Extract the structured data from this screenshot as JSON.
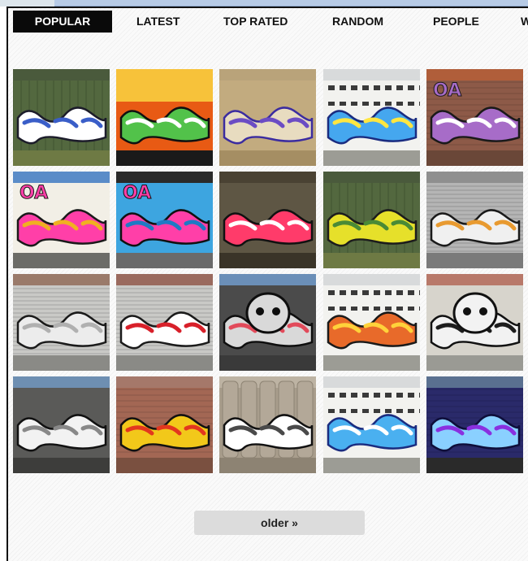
{
  "nav": {
    "tabs": [
      {
        "label": "POPULAR",
        "active": true
      },
      {
        "label": "LATEST"
      },
      {
        "label": "TOP RATED"
      },
      {
        "label": "RANDOM"
      },
      {
        "label": "PEOPLE"
      },
      {
        "label": "W"
      }
    ]
  },
  "gallery": {
    "tiles": [
      {
        "tag": "",
        "sky": "#4a5a3c",
        "wall": "#53683f",
        "ground": "#6e7a44",
        "c1": "#ffffff",
        "c2": "#3a5ec8",
        "stroke": "#1c1c2a",
        "kind": "train"
      },
      {
        "tag": "",
        "sky": "#f4a300",
        "wall": "#e85a14",
        "ground": "#1a1a1a",
        "c1": "#52c24a",
        "c2": "#ffffff",
        "stroke": "#111111",
        "kind": "sunset"
      },
      {
        "tag": "",
        "sky": "#b9a37a",
        "wall": "#c2ab7f",
        "ground": "#a58e63",
        "c1": "#e8dcc0",
        "c2": "#6b4cc4",
        "stroke": "#3b2ca0",
        "kind": "wall"
      },
      {
        "tag": "",
        "sky": "#d8dadb",
        "wall": "#f2f2ef",
        "ground": "#9c9c95",
        "c1": "#45a7ef",
        "c2": "#ffe640",
        "stroke": "#1a2c80",
        "kind": "ship"
      },
      {
        "tag": "OA",
        "sky": "#b05e3a",
        "wall": "#8d5a48",
        "ground": "#6a4738",
        "c1": "#a76cc8",
        "c2": "#ffffff",
        "stroke": "#1a1a1a",
        "kind": "brick"
      },
      {
        "tag": "OA",
        "sky": "#5a8cc8",
        "wall": "#f2efe6",
        "ground": "#6c6c68",
        "c1": "#ff3fa8",
        "c2": "#f0b021",
        "stroke": "#1a1a1a",
        "kind": "building"
      },
      {
        "tag": "OA",
        "sky": "#2a2a2a",
        "wall": "#3da5e0",
        "ground": "#6a6a6a",
        "c1": "#ff3fa8",
        "c2": "#1f7ac4",
        "stroke": "#111111",
        "kind": "wall"
      },
      {
        "tag": "",
        "sky": "#4a4233",
        "wall": "#5e5644",
        "ground": "#3a3428",
        "c1": "#ff3b6a",
        "c2": "#ffffff",
        "stroke": "#111111",
        "kind": "wall"
      },
      {
        "tag": "",
        "sky": "#4a5a3c",
        "wall": "#53683f",
        "ground": "#6e7a44",
        "c1": "#e6e02a",
        "c2": "#4a8a36",
        "stroke": "#1c1c1c",
        "kind": "train"
      },
      {
        "tag": "",
        "sky": "#8f8f8f",
        "wall": "#b5b5b5",
        "ground": "#7a7a7a",
        "c1": "#f0f0f0",
        "c2": "#e89a30",
        "stroke": "#1a1a1a",
        "kind": "shutter"
      },
      {
        "tag": "",
        "sky": "#9a7a6a",
        "wall": "#c9c9c6",
        "ground": "#8a8a86",
        "c1": "#ececec",
        "c2": "#b0b0b0",
        "stroke": "#1a1a1a",
        "kind": "shutter"
      },
      {
        "tag": "",
        "sky": "#9a6a5e",
        "wall": "#c9c9c6",
        "ground": "#8a8a86",
        "c1": "#ffffff",
        "c2": "#d8202a",
        "stroke": "#1a1a1a",
        "kind": "shutter"
      },
      {
        "tag": "",
        "sky": "#6b8fb8",
        "wall": "#4b4b4b",
        "ground": "#3a3a3a",
        "c1": "#d9d9d9",
        "c2": "#e24a5a",
        "stroke": "#0e0e0e",
        "kind": "face"
      },
      {
        "tag": "",
        "sky": "#d8dadb",
        "wall": "#f2f2ef",
        "ground": "#9c9c95",
        "c1": "#e86a2a",
        "c2": "#ffd23a",
        "stroke": "#1a1a1a",
        "kind": "ship"
      },
      {
        "tag": "",
        "sky": "#b8796a",
        "wall": "#d7d4cc",
        "ground": "#9a9a94",
        "c1": "#f2f2f2",
        "c2": "#1d1d1d",
        "stroke": "#111111",
        "kind": "face"
      },
      {
        "tag": "",
        "sky": "#6e8fb2",
        "wall": "#5a5a58",
        "ground": "#3d3d3b",
        "c1": "#f2f2f2",
        "c2": "#888888",
        "stroke": "#111111",
        "kind": "building"
      },
      {
        "tag": "",
        "sky": "#a5786a",
        "wall": "#a36754",
        "ground": "#7a5040",
        "c1": "#f2c81a",
        "c2": "#e3371e",
        "stroke": "#111111",
        "kind": "brick"
      },
      {
        "tag": "",
        "sky": "#bdb3a3",
        "wall": "#a89d8c",
        "ground": "#8d8373",
        "c1": "#ffffff",
        "c2": "#4a4a4a",
        "stroke": "#111111",
        "kind": "silo"
      },
      {
        "tag": "",
        "sky": "#d8dadb",
        "wall": "#f2f2ef",
        "ground": "#9c9c95",
        "c1": "#4ab0f0",
        "c2": "#ffffff",
        "stroke": "#1a2c80",
        "kind": "ship"
      },
      {
        "tag": "",
        "sky": "#5a7090",
        "wall": "#2a2a6a",
        "ground": "#2a2a2a",
        "c1": "#8ad0ff",
        "c2": "#8a30e0",
        "stroke": "#0e0e3a",
        "kind": "brick"
      }
    ]
  },
  "pagination": {
    "older_label": "older »"
  }
}
